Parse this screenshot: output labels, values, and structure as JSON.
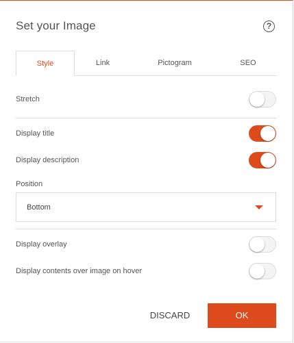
{
  "dialog": {
    "title": "Set your Image",
    "help_icon": "question-circle-icon",
    "help_glyph": "?"
  },
  "tabs": [
    {
      "label": "Style",
      "active": true
    },
    {
      "label": "Link",
      "active": false
    },
    {
      "label": "Pictogram",
      "active": false
    },
    {
      "label": "SEO",
      "active": false
    }
  ],
  "settings": {
    "stretch": {
      "label": "Stretch",
      "enabled": false
    },
    "display_title": {
      "label": "Display title",
      "enabled": true
    },
    "display_description": {
      "label": "Display description",
      "enabled": true
    },
    "position": {
      "label": "Position",
      "selected": "Bottom"
    },
    "display_overlay": {
      "label": "Display overlay",
      "enabled": false
    },
    "display_contents_hover": {
      "label": "Display contents over image on hover",
      "enabled": false
    }
  },
  "footer": {
    "discard_label": "DISCARD",
    "ok_label": "OK"
  },
  "colors": {
    "accent": "#dd4b1c",
    "text": "#555555",
    "divider": "#dddddd"
  }
}
